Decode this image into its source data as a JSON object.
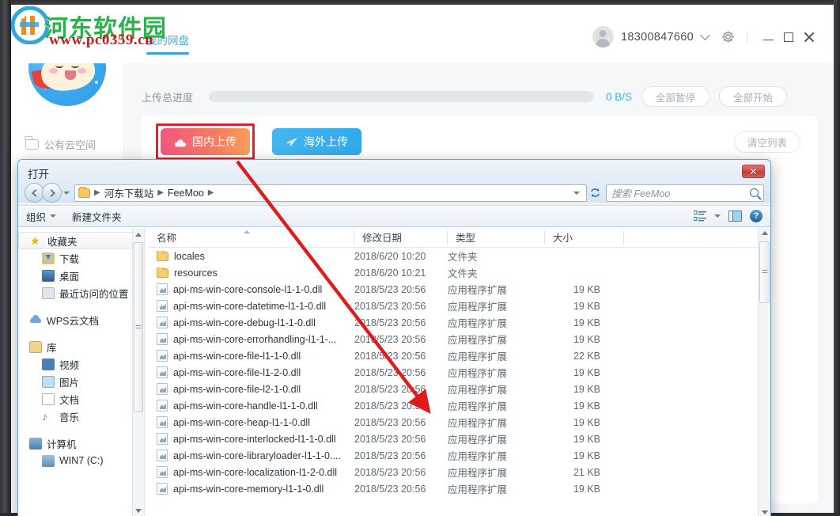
{
  "watermark": {
    "site": "河东软件园",
    "url": "www.pc0359.cn"
  },
  "app": {
    "tab": {
      "label": "我的网盘"
    },
    "sidebar": {
      "cloud_space_label": "公有云空间"
    },
    "user": {
      "phone": "18300847660"
    },
    "window_controls": {
      "minimize": "minimize-icon",
      "maximize": "maximize-icon",
      "close": "close-icon"
    },
    "progress": {
      "label": "上传总进度",
      "speed": "0 B/S",
      "pause_all": "全部暂停",
      "start_all": "全部开始"
    },
    "upload": {
      "domestic": "国内上传",
      "overseas": "海外上传",
      "clear_list": "清空列表"
    }
  },
  "dialog": {
    "title": "打开",
    "close_glyph": "✕",
    "breadcrumbs": [
      "河东下载站",
      "FeeMoo"
    ],
    "search_placeholder": "搜索 FeeMoo",
    "toolbar": {
      "organize": "组织",
      "new_folder": "新建文件夹"
    },
    "nav_groups": [
      {
        "label": "收藏夹",
        "icon": "star-icon",
        "selected": true,
        "children": [
          {
            "label": "下载",
            "icon": "downloads-icon"
          },
          {
            "label": "桌面",
            "icon": "desktop-icon"
          },
          {
            "label": "最近访问的位置",
            "icon": "recent-places-icon"
          }
        ]
      },
      {
        "label": "WPS云文档",
        "icon": "cloud-icon",
        "children": []
      },
      {
        "label": "库",
        "icon": "library-icon",
        "children": [
          {
            "label": "视频",
            "icon": "video-icon"
          },
          {
            "label": "图片",
            "icon": "pictures-icon"
          },
          {
            "label": "文档",
            "icon": "documents-icon"
          },
          {
            "label": "音乐",
            "icon": "music-icon"
          }
        ]
      },
      {
        "label": "计算机",
        "icon": "computer-icon",
        "children": [
          {
            "label": "WIN7 (C:)",
            "icon": "harddisk-icon"
          }
        ]
      }
    ],
    "columns": [
      "名称",
      "修改日期",
      "类型",
      "大小"
    ],
    "files": [
      {
        "name": "locales",
        "date": "2018/6/20 10:20",
        "type": "文件夹",
        "size": "",
        "icon": "folder-icon"
      },
      {
        "name": "resources",
        "date": "2018/6/20 10:21",
        "type": "文件夹",
        "size": "",
        "icon": "folder-icon"
      },
      {
        "name": "api-ms-win-core-console-l1-1-0.dll",
        "date": "2018/5/23 20:56",
        "type": "应用程序扩展",
        "size": "19 KB",
        "icon": "dll-icon"
      },
      {
        "name": "api-ms-win-core-datetime-l1-1-0.dll",
        "date": "2018/5/23 20:56",
        "type": "应用程序扩展",
        "size": "19 KB",
        "icon": "dll-icon"
      },
      {
        "name": "api-ms-win-core-debug-l1-1-0.dll",
        "date": "2018/5/23 20:56",
        "type": "应用程序扩展",
        "size": "19 KB",
        "icon": "dll-icon"
      },
      {
        "name": "api-ms-win-core-errorhandling-l1-1-...",
        "date": "2018/5/23 20:56",
        "type": "应用程序扩展",
        "size": "19 KB",
        "icon": "dll-icon"
      },
      {
        "name": "api-ms-win-core-file-l1-1-0.dll",
        "date": "2018/5/23 20:56",
        "type": "应用程序扩展",
        "size": "22 KB",
        "icon": "dll-icon"
      },
      {
        "name": "api-ms-win-core-file-l1-2-0.dll",
        "date": "2018/5/23 20:56",
        "type": "应用程序扩展",
        "size": "19 KB",
        "icon": "dll-icon"
      },
      {
        "name": "api-ms-win-core-file-l2-1-0.dll",
        "date": "2018/5/23 20:56",
        "type": "应用程序扩展",
        "size": "19 KB",
        "icon": "dll-icon"
      },
      {
        "name": "api-ms-win-core-handle-l1-1-0.dll",
        "date": "2018/5/23 20:56",
        "type": "应用程序扩展",
        "size": "19 KB",
        "icon": "dll-icon"
      },
      {
        "name": "api-ms-win-core-heap-l1-1-0.dll",
        "date": "2018/5/23 20:56",
        "type": "应用程序扩展",
        "size": "19 KB",
        "icon": "dll-icon"
      },
      {
        "name": "api-ms-win-core-interlocked-l1-1-0.dll",
        "date": "2018/5/23 20:56",
        "type": "应用程序扩展",
        "size": "19 KB",
        "icon": "dll-icon"
      },
      {
        "name": "api-ms-win-core-libraryloader-l1-1-0....",
        "date": "2018/5/23 20:56",
        "type": "应用程序扩展",
        "size": "19 KB",
        "icon": "dll-icon"
      },
      {
        "name": "api-ms-win-core-localization-l1-2-0.dll",
        "date": "2018/5/23 20:56",
        "type": "应用程序扩展",
        "size": "21 KB",
        "icon": "dll-icon"
      },
      {
        "name": "api-ms-win-core-memory-l1-1-0.dll",
        "date": "2018/5/23 20:56",
        "type": "应用程序扩展",
        "size": "19 KB",
        "icon": "dll-icon"
      }
    ]
  },
  "colors": {
    "accent_blue": "#3aa0e3",
    "domestic_gradient_start": "#f2567e",
    "domestic_gradient_end": "#f8a25a",
    "overseas_blue": "#2fa9ec",
    "annotation_red": "#e81e25",
    "speed_cyan": "#3fb6e0"
  }
}
